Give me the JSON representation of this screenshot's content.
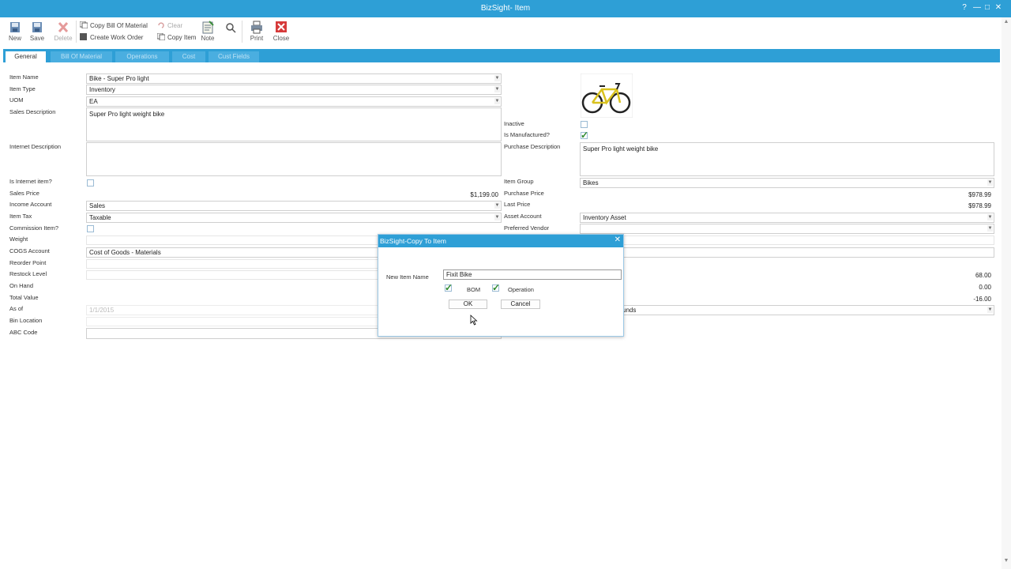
{
  "window": {
    "title": "BizSight- Item"
  },
  "toolbar": {
    "new": "New",
    "save": "Save",
    "delete": "Delete",
    "copy_bom": "Copy Bill Of Material",
    "create_wo": "Create Work Order",
    "clear": "Clear",
    "copy_item": "Copy Item",
    "note": "Note",
    "print": "Print",
    "close": "Close"
  },
  "tabs": [
    "General",
    "Bill Of Material",
    "Operations",
    "Cost",
    "Cust Fields"
  ],
  "form": {
    "item_name": {
      "label": "Item Name",
      "value": "Bike - Super Pro light"
    },
    "item_type": {
      "label": "Item Type",
      "value": "Inventory"
    },
    "uom": {
      "label": "UOM",
      "value": "EA"
    },
    "sales_description": {
      "label": "Sales Description",
      "value": "Super Pro light weight bike"
    },
    "internet_description": {
      "label": "Internet Description",
      "value": ""
    },
    "is_internet_item": {
      "label": "Is Internet item?"
    },
    "sales_price": {
      "label": "Sales Price",
      "value": "$1,199.00"
    },
    "income_account": {
      "label": "Income Account",
      "value": "Sales"
    },
    "item_tax": {
      "label": "Item Tax",
      "value": "Taxable"
    },
    "commission_item": {
      "label": "Commission Item?"
    },
    "weight": {
      "label": "Weight"
    },
    "cogs_account": {
      "label": "COGS Account",
      "value": "Cost of Goods - Materials"
    },
    "reorder_point": {
      "label": "Reorder Point"
    },
    "restock_level": {
      "label": "Restock Level"
    },
    "on_hand": {
      "label": "On Hand",
      "value": "68.00"
    },
    "total_value": {
      "label": "Total Value",
      "value": "0.00"
    },
    "as_of": {
      "label": "As of",
      "value": "1/1/2015",
      "right_value": "-16.00"
    },
    "bin_location": {
      "label": "Bin Location",
      "value": "unds"
    },
    "abc_code": {
      "label": "ABC Code"
    },
    "inactive": {
      "label": "Inactive"
    },
    "is_manufactured": {
      "label": "Is Manufactured?"
    },
    "purchase_description": {
      "label": "Purchase Description",
      "value": "Super Pro light weight bike"
    },
    "item_group": {
      "label": "Item Group",
      "value": "Bikes"
    },
    "purchase_price": {
      "label": "Purchase Price",
      "value": "$978.99"
    },
    "last_price": {
      "label": "Last Price",
      "value": "$978.99"
    },
    "asset_account": {
      "label": "Asset Account",
      "value": "Inventory Asset"
    },
    "preferred_vendor": {
      "label": "Preferred Vendor"
    }
  },
  "dialog": {
    "title": "BizSight-Copy To Item",
    "new_item_label": "New Item Name",
    "new_item_value": "Fixit Bike",
    "bom_label": "BOM",
    "bom_checked": true,
    "operation_label": "Operation",
    "operation_checked": true,
    "ok": "OK",
    "cancel": "Cancel"
  },
  "colors": {
    "accent": "#2e9fd6",
    "check": "#2f8a2f"
  }
}
